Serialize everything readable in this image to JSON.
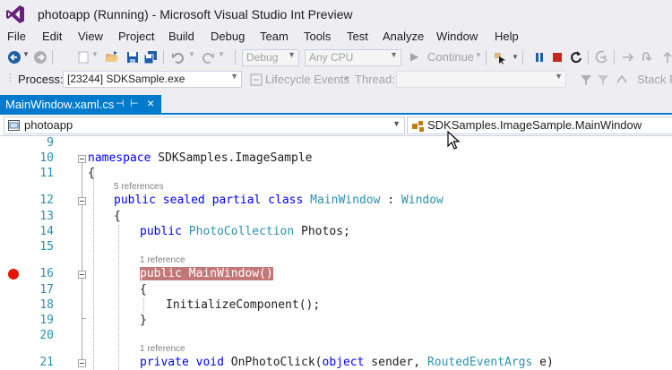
{
  "window": {
    "title": "photoapp (Running) - Microsoft Visual Studio Int Preview"
  },
  "menu": [
    "File",
    "Edit",
    "View",
    "Project",
    "Build",
    "Debug",
    "Team",
    "Tools",
    "Test",
    "Analyze",
    "Window",
    "Help"
  ],
  "toolbar": {
    "config": "Debug",
    "platform": "Any CPU",
    "continue_label": "Continue"
  },
  "debug_bar": {
    "process_label": "Process:",
    "process_value": "[23244] SDKSample.exe",
    "lifecycle_label": "Lifecycle Events",
    "thread_label": "Thread:",
    "stack_label": "Stack F"
  },
  "document_tab": {
    "name": "MainWindow.xaml.cs"
  },
  "navigation": {
    "project": "photoapp",
    "member": "SDKSamples.ImageSample.MainWindow"
  },
  "editor": {
    "lines": [
      {
        "no": "9"
      },
      {
        "no": "10",
        "kw": "namespace",
        "text": " SDKSamples.ImageSample"
      },
      {
        "no": "11",
        "text": "{"
      },
      {
        "no": "12",
        "ref": "5 references",
        "kw": "public sealed partial class",
        "ty1": "MainWindow",
        "mid": " : ",
        "ty2": "Window"
      },
      {
        "no": "13",
        "text": "{"
      },
      {
        "no": "14",
        "kw": "public",
        "ty1": "PhotoCollection",
        "text": " Photos;"
      },
      {
        "no": "15"
      },
      {
        "no": "16",
        "ref": "1 reference",
        "kw": "public",
        "text": " MainWindow()"
      },
      {
        "no": "17",
        "text": "{"
      },
      {
        "no": "18",
        "text": "InitializeComponent();"
      },
      {
        "no": "19",
        "text": "}"
      },
      {
        "no": "20"
      },
      {
        "no": "21",
        "ref": "1 reference",
        "kw": "private void",
        "text1": " OnPhotoClick(",
        "kw2": "object",
        "text2": " sender, ",
        "ty1": "RoutedEventArgs",
        "text3": " e)"
      }
    ]
  }
}
